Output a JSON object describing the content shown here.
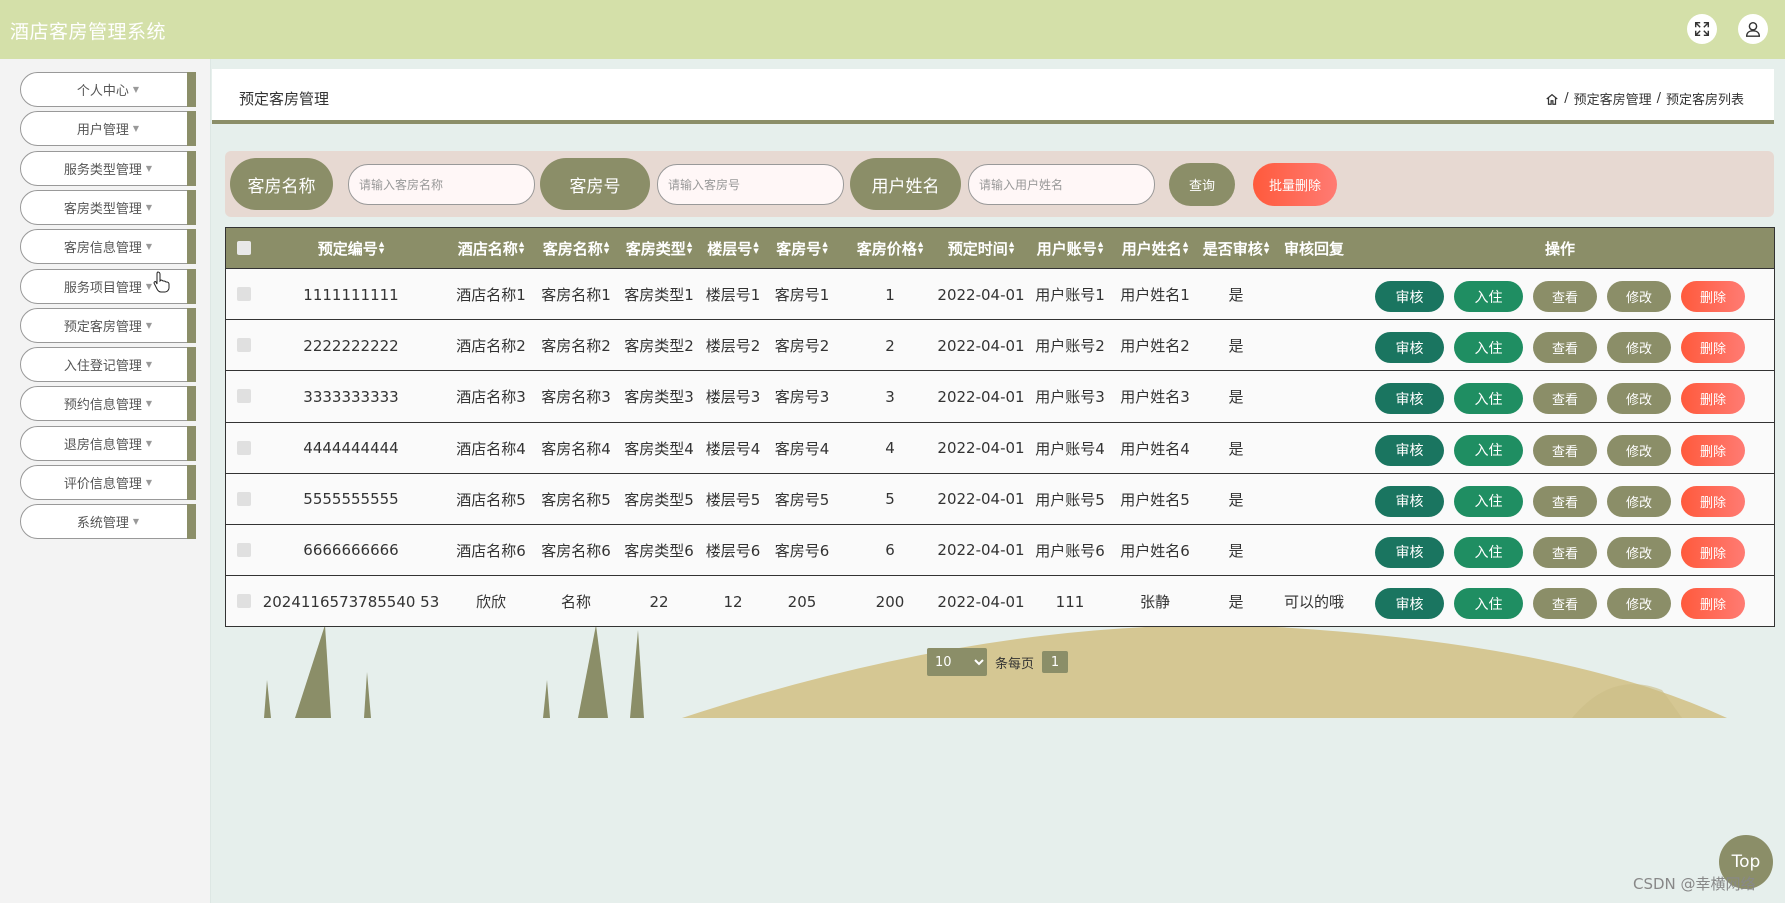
{
  "app": {
    "title": "酒店客房管理系统"
  },
  "icons": {
    "fullscreen": "expand-icon",
    "user": "user-icon",
    "home": "home-icon"
  },
  "sidebar": {
    "items": [
      {
        "label": "个人中心"
      },
      {
        "label": "用户管理"
      },
      {
        "label": "服务类型管理"
      },
      {
        "label": "客房类型管理"
      },
      {
        "label": "客房信息管理"
      },
      {
        "label": "服务项目管理"
      },
      {
        "label": "预定客房管理"
      },
      {
        "label": "入住登记管理"
      },
      {
        "label": "预约信息管理"
      },
      {
        "label": "退房信息管理"
      },
      {
        "label": "评价信息管理"
      },
      {
        "label": "系统管理"
      }
    ]
  },
  "page": {
    "title": "预定客房管理",
    "breadcrumb": [
      "/",
      "预定客房管理",
      "/",
      "预定客房列表"
    ]
  },
  "search": {
    "room_name_label": "客房名称",
    "room_name_placeholder": "请输入客房名称",
    "room_no_label": "客房号",
    "room_no_placeholder": "请输入客房号",
    "user_name_label": "用户姓名",
    "user_name_placeholder": "请输入用户姓名",
    "query_label": "查询",
    "batch_delete_label": "批量删除"
  },
  "table": {
    "columns": [
      "预定编号",
      "酒店名称",
      "客房名称",
      "客房类型",
      "楼层号",
      "客房号",
      "客房价格",
      "预定时间",
      "用户账号",
      "用户姓名",
      "是否审核",
      "审核回复",
      "操作"
    ],
    "rows": [
      [
        "1111111111",
        "酒店名称1",
        "客房名称1",
        "客房类型1",
        "楼层号1",
        "客房号1",
        "1",
        "2022-04-01",
        "用户账号1",
        "用户姓名1",
        "是",
        ""
      ],
      [
        "2222222222",
        "酒店名称2",
        "客房名称2",
        "客房类型2",
        "楼层号2",
        "客房号2",
        "2",
        "2022-04-01",
        "用户账号2",
        "用户姓名2",
        "是",
        ""
      ],
      [
        "3333333333",
        "酒店名称3",
        "客房名称3",
        "客房类型3",
        "楼层号3",
        "客房号3",
        "3",
        "2022-04-01",
        "用户账号3",
        "用户姓名3",
        "是",
        ""
      ],
      [
        "4444444444",
        "酒店名称4",
        "客房名称4",
        "客房类型4",
        "楼层号4",
        "客房号4",
        "4",
        "2022-04-01",
        "用户账号4",
        "用户姓名4",
        "是",
        ""
      ],
      [
        "5555555555",
        "酒店名称5",
        "客房名称5",
        "客房类型5",
        "楼层号5",
        "客房号5",
        "5",
        "2022-04-01",
        "用户账号5",
        "用户姓名5",
        "是",
        ""
      ],
      [
        "6666666666",
        "酒店名称6",
        "客房名称6",
        "客房类型6",
        "楼层号6",
        "客房号6",
        "6",
        "2022-04-01",
        "用户账号6",
        "用户姓名6",
        "是",
        ""
      ],
      [
        "2024116573785540 53",
        "欣欣",
        "名称",
        "22",
        "12",
        "205",
        "200",
        "2022-04-01",
        "111",
        "张静",
        "是",
        "可以的哦"
      ]
    ],
    "actions": {
      "audit": "审核",
      "checkin": "入住",
      "view": "查看",
      "edit": "修改",
      "delete": "删除"
    }
  },
  "pager": {
    "page_size": "10",
    "per_page_text": "条每页",
    "current_page": "1"
  },
  "back_to_top": "Top",
  "watermark": "CSDN @幸横网络",
  "colors": {
    "header": "#d4e0a9",
    "accent": "#8b8e68",
    "audit": "#1a7560",
    "checkin": "#1f8e62",
    "danger": "#ff5a3c"
  }
}
